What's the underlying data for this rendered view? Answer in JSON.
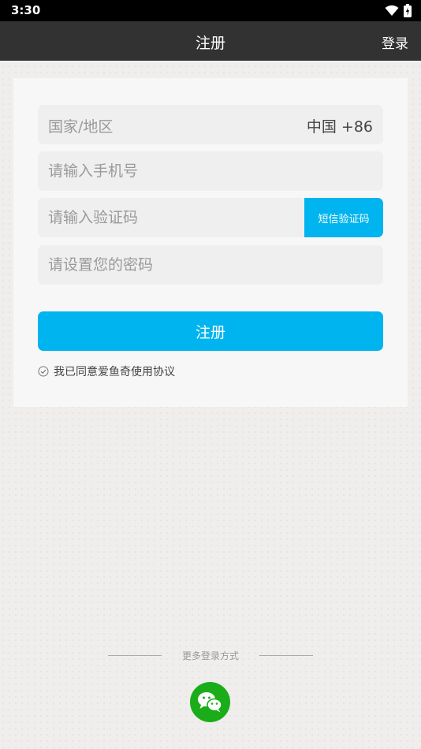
{
  "status_bar": {
    "time": "3:30"
  },
  "header": {
    "title": "注册",
    "login_label": "登录"
  },
  "form": {
    "country_label": "国家/地区",
    "country_value": "中国 +86",
    "phone_placeholder": "请输入手机号",
    "code_placeholder": "请输入验证码",
    "sms_button_label": "短信验证码",
    "password_placeholder": "请设置您的密码",
    "register_label": "注册",
    "agreement_label": "我已同意爱鱼奇使用协议"
  },
  "more_login": {
    "label": "更多登录方式",
    "options": [
      "wechat-icon"
    ]
  },
  "colors": {
    "accent": "#00b4ef",
    "header_bg": "#323232",
    "status_bg": "#000000",
    "wechat": "#1aad19"
  }
}
